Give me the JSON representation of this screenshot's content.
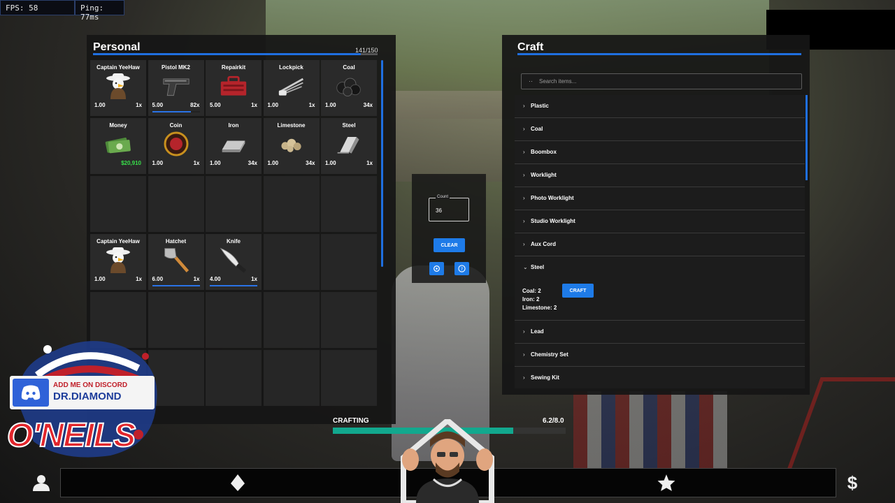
{
  "hud": {
    "fps": "FPS: 58",
    "ping": "Ping: 77ms"
  },
  "personal": {
    "title": "Personal",
    "weight": "141/150",
    "weight_fraction": 0.94,
    "slots": [
      {
        "name": "Captain YeeHaw",
        "weight": "1.00",
        "count": "1x",
        "icon": "eagle-cowboy-icon"
      },
      {
        "name": "Pistol MK2",
        "weight": "5.00",
        "count": "82x",
        "icon": "pistol-icon",
        "durability": 0.82
      },
      {
        "name": "Repairkit",
        "weight": "5.00",
        "count": "1x",
        "icon": "toolbox-icon"
      },
      {
        "name": "Lockpick",
        "weight": "1.00",
        "count": "1x",
        "icon": "lockpick-icon"
      },
      {
        "name": "Coal",
        "weight": "1.00",
        "count": "34x",
        "icon": "coal-icon"
      },
      {
        "name": "Money",
        "money": "$20,910",
        "icon": "money-icon"
      },
      {
        "name": "Coin",
        "weight": "1.00",
        "count": "1x",
        "icon": "coin-icon"
      },
      {
        "name": "Iron",
        "weight": "1.00",
        "count": "34x",
        "icon": "iron-bar-icon"
      },
      {
        "name": "Limestone",
        "weight": "1.00",
        "count": "34x",
        "icon": "limestone-icon"
      },
      {
        "name": "Steel",
        "weight": "1.00",
        "count": "1x",
        "icon": "steel-bar-icon"
      }
    ],
    "hotbar_slots": [
      {
        "name": "Captain YeeHaw",
        "weight": "1.00",
        "count": "1x",
        "icon": "eagle-cowboy-icon"
      },
      {
        "name": "Hatchet",
        "weight": "6.00",
        "count": "1x",
        "icon": "hatchet-icon",
        "durability": 1.0
      },
      {
        "name": "Knife",
        "weight": "4.00",
        "count": "1x",
        "icon": "knife-icon",
        "durability": 1.0
      }
    ]
  },
  "count_widget": {
    "label": "Count",
    "value": "36",
    "clear_label": "CLEAR"
  },
  "craft": {
    "title": "Craft",
    "search_placeholder": "Search items...",
    "items": [
      "Plastic",
      "Coal",
      "Boombox",
      "Worklight",
      "Photo Worklight",
      "Studio Worklight",
      "Aux Cord"
    ],
    "expanded": {
      "name": "Steel",
      "requirements": [
        "Coal: 2",
        "Iron: 2",
        "Limestone: 2"
      ],
      "craft_label": "CRAFT"
    },
    "items_after": [
      "Lead",
      "Chemistry Set",
      "Sewing Kit"
    ]
  },
  "progress": {
    "label": "CRAFTING",
    "value_text": "6.2/8.0",
    "fraction": 0.775
  },
  "overlay": {
    "discord_top": "ADD ME ON DISCORD",
    "discord_name": "DR.DIAMOND",
    "brand": "O'NEILS"
  },
  "colors": {
    "accent": "#1e7be8",
    "money": "#38e04a",
    "progress": "#12a88e"
  }
}
